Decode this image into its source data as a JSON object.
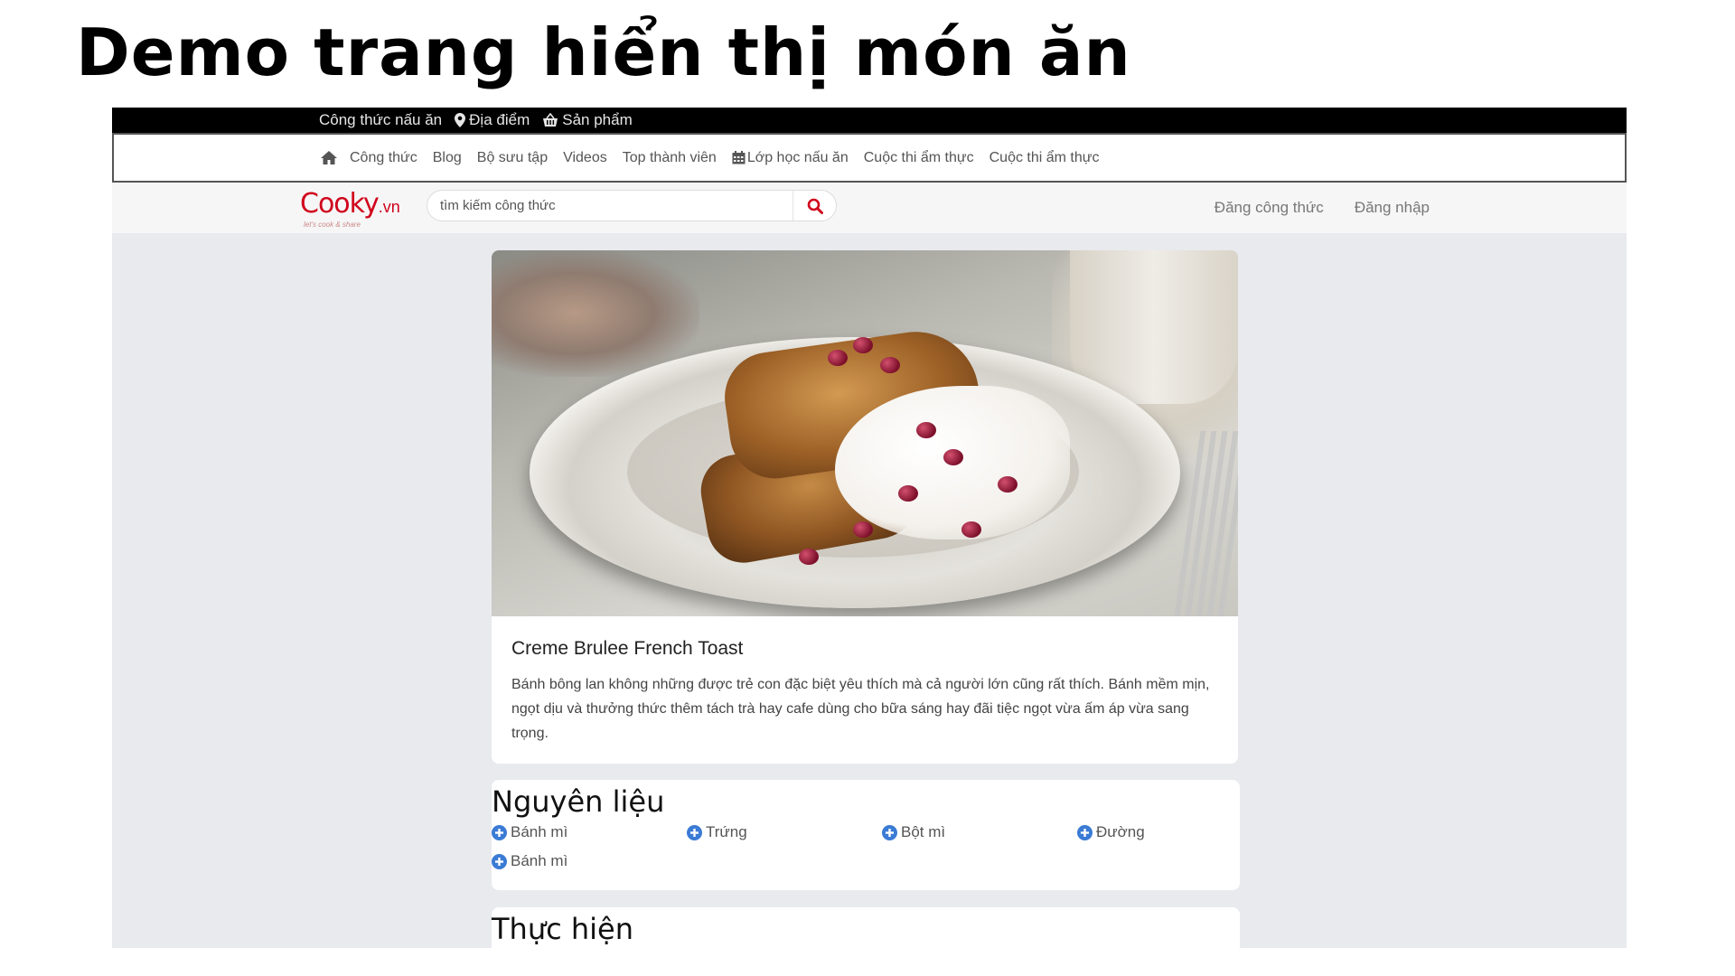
{
  "slide": {
    "title": "Demo trang hiển thị món ăn"
  },
  "topbar": {
    "items": [
      {
        "label": "Công thức nấu ăn",
        "icon": ""
      },
      {
        "label": "Địa điểm",
        "icon": "map-marker-icon"
      },
      {
        "label": "Sản phẩm",
        "icon": "basket-icon"
      }
    ]
  },
  "navbar": {
    "home_icon": "home-icon",
    "items": [
      "Công thức",
      "Blog",
      "Bộ sưu tập",
      "Videos",
      "Top thành viên",
      "Lớp học nấu ăn",
      "Cuộc thi ẩm thực",
      "Cuộc thi ẩm thực"
    ],
    "calendar_icon": "calendar-icon"
  },
  "header": {
    "logo": "Cooky",
    "logo_suffix": ".vn",
    "logo_tagline": "let's cook & share",
    "search_placeholder": "tìm kiếm công thức",
    "search_icon": "search-icon",
    "post_recipe": "Đăng công thức",
    "login": "Đăng nhập"
  },
  "recipe": {
    "title": "Creme Brulee French Toast",
    "description": "Bánh bông lan không những được trẻ con đặc biệt yêu thích mà cả người lớn cũng rất thích. Bánh mềm mịn, ngọt dịu và thưởng thức thêm tách trà hay cafe dùng cho bữa sáng hay đãi tiệc ngọt vừa ấm áp vừa sang trọng."
  },
  "ingredients": {
    "heading": "Nguyên liệu",
    "icon": "plus-circle-icon",
    "items": [
      "Bánh mì",
      "Trứng",
      "Bột mì",
      "Đường",
      "Bánh mì"
    ]
  },
  "steps": {
    "heading": "Thực hiện"
  },
  "colors": {
    "brand": "#d0021b",
    "plus_icon": "#3a7bd5",
    "page_bg": "#e9eaee"
  }
}
